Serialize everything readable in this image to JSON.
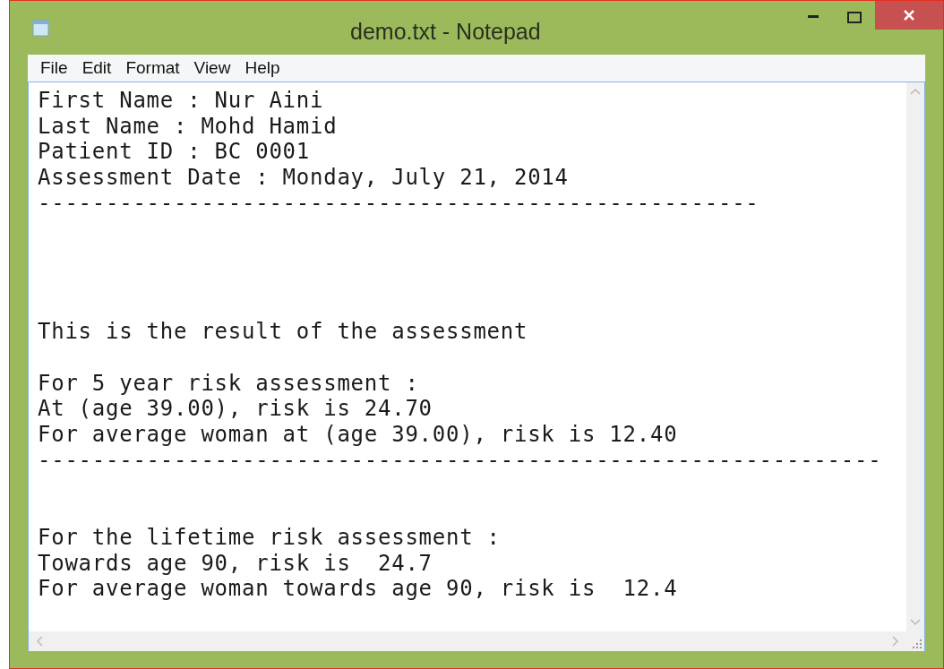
{
  "window": {
    "title": "demo.txt - Notepad"
  },
  "menu": [
    "File",
    "Edit",
    "Format",
    "View",
    "Help"
  ],
  "document": {
    "text": "First Name : Nur Aini\nLast Name : Mohd Hamid\nPatient ID : BC 0001\nAssessment Date : Monday, July 21, 2014\n-----------------------------------------------------\n\n\n\n\nThis is the result of the assessment\n\nFor 5 year risk assessment :\nAt (age 39.00), risk is 24.70\nFor average woman at (age 39.00), risk is 12.40\n--------------------------------------------------------------\n\n\nFor the lifetime risk assessment :\nTowards age 90, risk is  24.7\nFor average woman towards age 90, risk is  12.4"
  }
}
